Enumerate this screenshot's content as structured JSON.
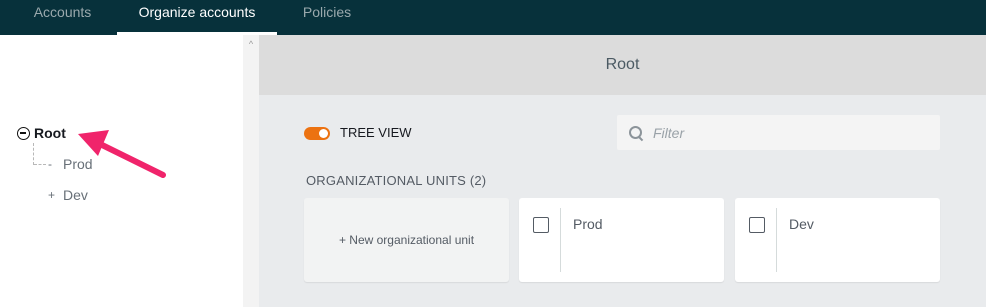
{
  "nav": {
    "tabs": [
      {
        "label": "Accounts",
        "active": false
      },
      {
        "label": "Organize accounts",
        "active": true
      },
      {
        "label": "Policies",
        "active": false
      }
    ]
  },
  "tree": {
    "root": "Root",
    "children": [
      {
        "label": "Prod",
        "toggle": "-"
      },
      {
        "label": "Dev",
        "toggle": "+"
      }
    ]
  },
  "main": {
    "title": "Root",
    "tree_view_label": "TREE VIEW",
    "filter_placeholder": "Filter",
    "ou_heading": "ORGANIZATIONAL UNITS (2)",
    "new_ou_label": "+ New organizational unit",
    "cards": [
      {
        "name": "Prod"
      },
      {
        "name": "Dev"
      }
    ]
  },
  "colors": {
    "nav_bg": "#07313b",
    "toggle_on": "#ec7211",
    "annotation_arrow": "#f0246b"
  }
}
